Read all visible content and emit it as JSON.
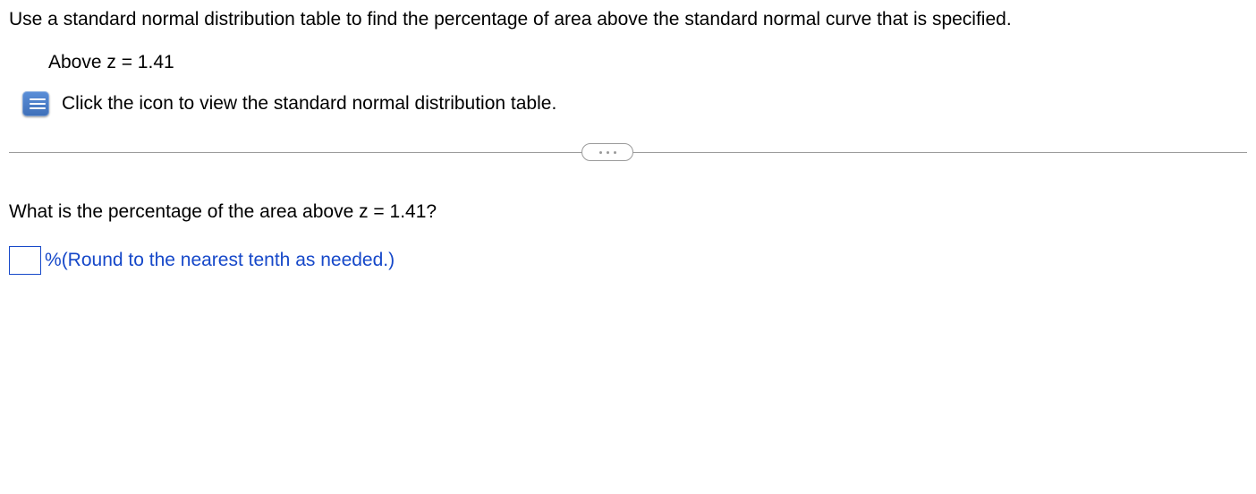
{
  "problem": {
    "statement": "Use a standard normal distribution table to find the percentage of area above the standard normal curve that is specified.",
    "condition": "Above z = 1.41",
    "icon_hint": "Click the icon to view the standard normal distribution table."
  },
  "question": {
    "prompt": "What is the percentage of the area above z = 1.41?",
    "unit_label": "%",
    "rounding_hint": " (Round to the nearest tenth as needed.)",
    "answer_value": ""
  }
}
